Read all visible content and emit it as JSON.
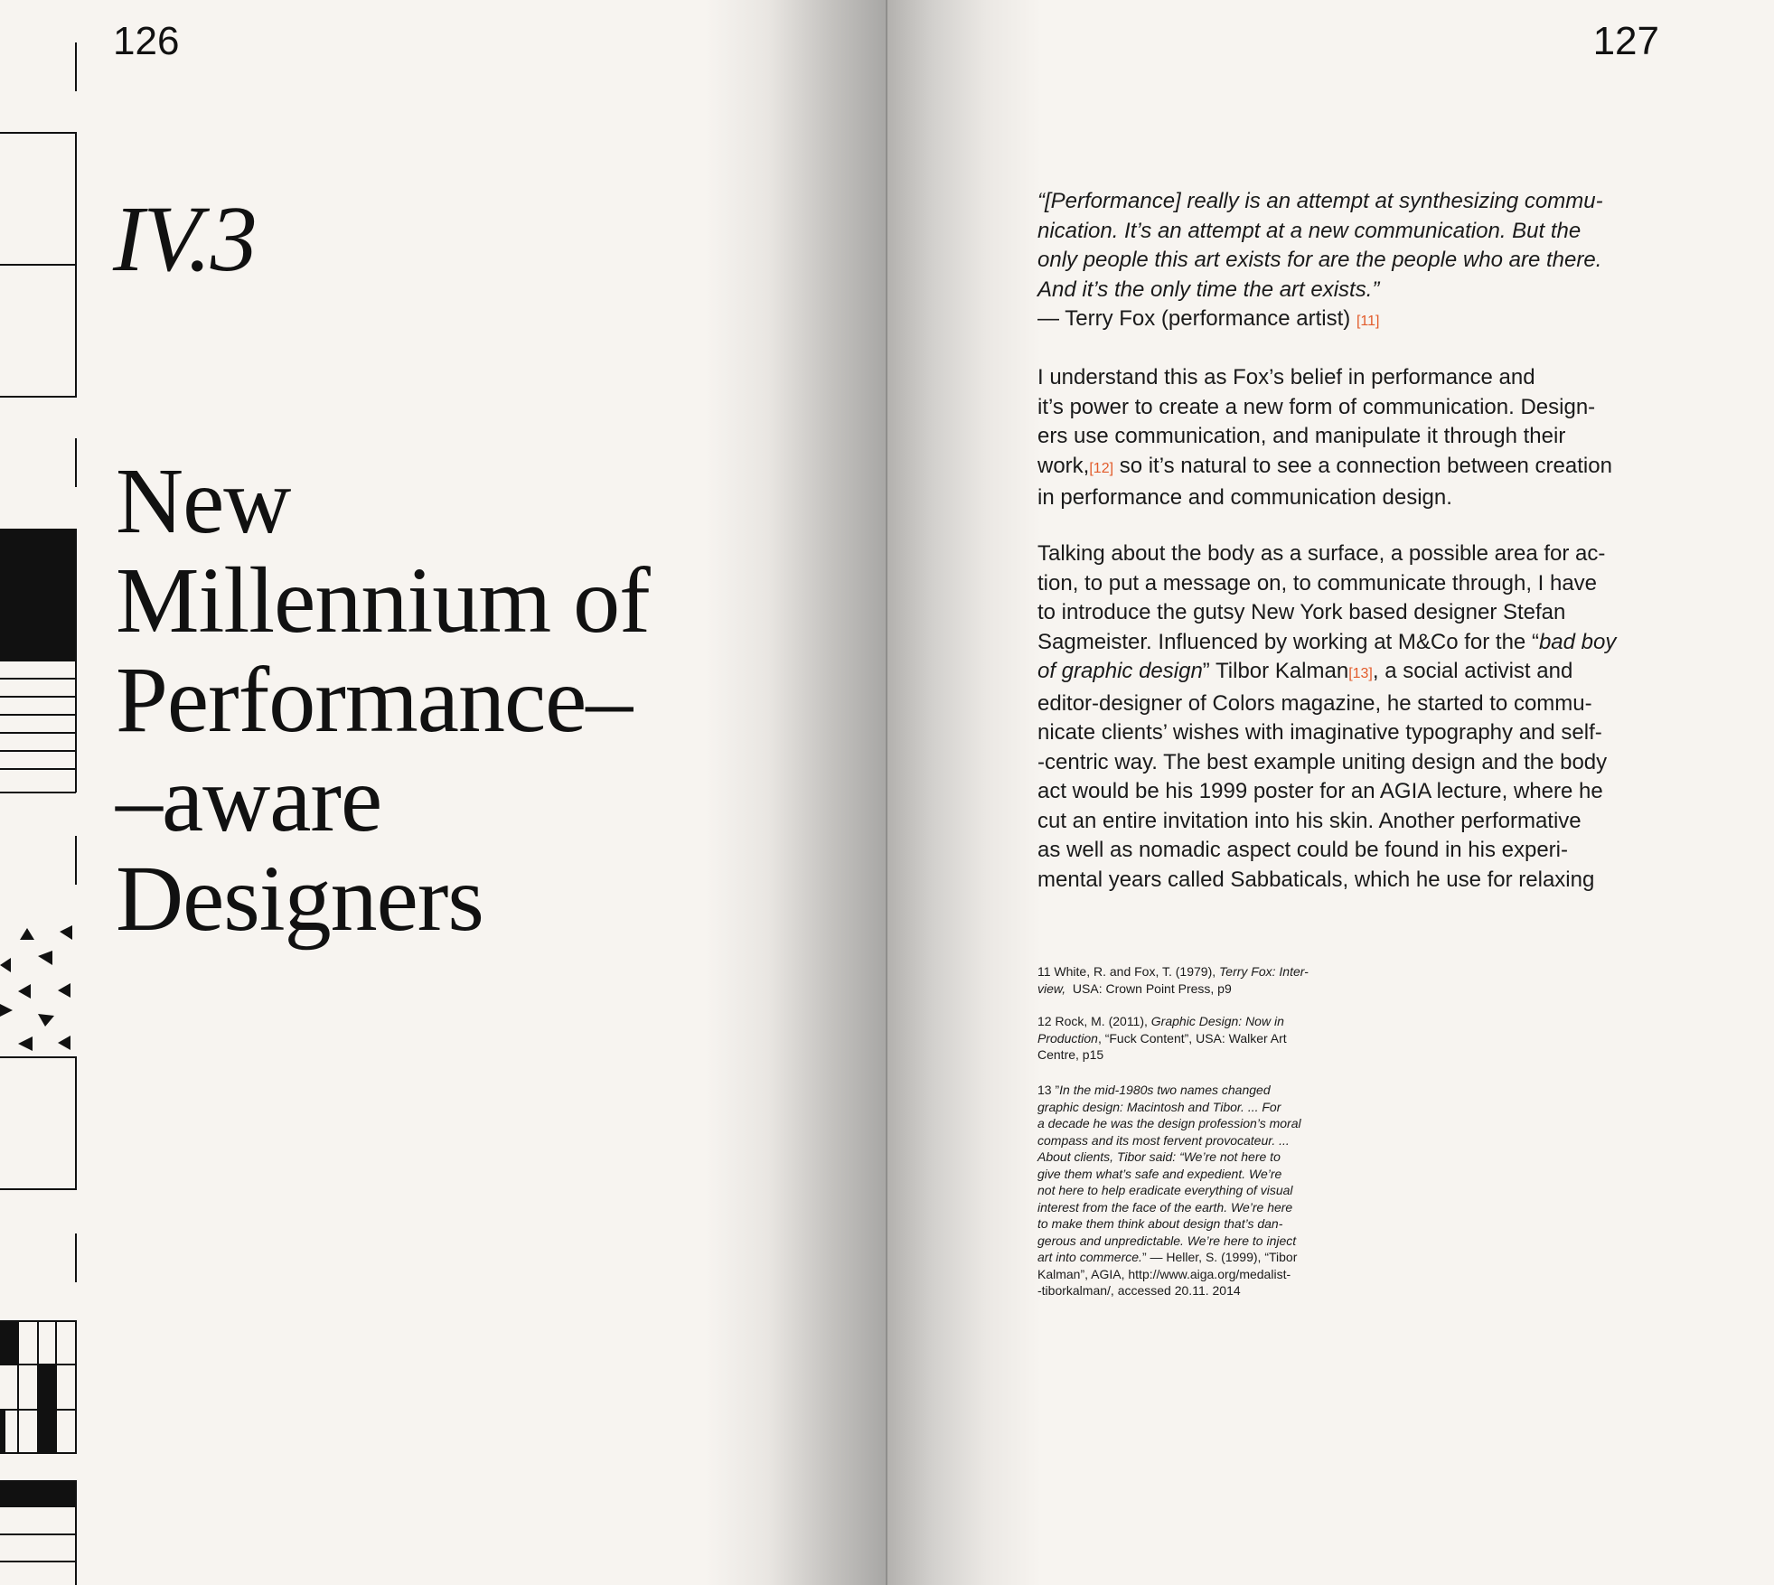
{
  "left_page": {
    "page_number": "126",
    "section_number": "IV.3",
    "title_lines": [
      "New",
      "Millennium of",
      "Performance–",
      "–aware",
      "Designers"
    ]
  },
  "right_page": {
    "page_number": "127",
    "quote_lines": [
      "“[Performance] really is an attempt at synthesizing commu-",
      "nication. It’s an attempt at a new communication. But the",
      "only people this art exists for are the people who are there.",
      "And it’s the only time the art exists.”"
    ],
    "attribution": "— Terry Fox (performance artist)",
    "attribution_ref": "[11]",
    "paragraph1": {
      "line1": "I understand this as Fox’s belief in performance and",
      "line2": "it’s power to create a new form of communication. Design-",
      "line3": "ers use communication, and manipulate it through their",
      "line4_a": "work,",
      "line4_ref": "[12]",
      "line4_b": " so it’s natural to see a connection between creation",
      "line5": "in performance and communication design."
    },
    "paragraph2": {
      "line1": "Talking about the body as a surface, a possible area for ac-",
      "line2": "tion, to put a message on, to communicate through, I have",
      "line3": "to introduce the gutsy New York based designer Stefan",
      "line4_a": "Sagmeister. Influenced by working at M&Co for the “",
      "line4_i": "bad boy",
      "line5_i": "of graphic design",
      "line5_b": "” Tilbor Kalman",
      "line5_ref": "[13]",
      "line5_c": ", a social activist and",
      "line6": "editor-designer of Colors magazine, he started to commu-",
      "line7": "nicate clients’ wishes with imaginative typography and self-",
      "line8": "-centric way. The best example uniting design and the body",
      "line9": "act would be his 1999 poster for an AGIA lecture, where he",
      "line10": "cut an entire invitation into his skin. Another performative",
      "line11": "as well as nomadic aspect could be found in his experi-",
      "line12": "mental years called Sabbaticals, which he use for relaxing"
    },
    "footnotes": {
      "fn11": {
        "line1_a": "11 White, R. and Fox, T. (1979), ",
        "line1_i": "Terry Fox: Inter-",
        "line2_i": "view,",
        "line2_b": "  USA: Crown Point Press, p9"
      },
      "fn12": {
        "line1_a": "12 Rock, M. (2011), ",
        "line1_i": "Graphic Design: Now in",
        "line2_i": "Production",
        "line2_b": ", “Fuck Content”, USA: Walker Art",
        "line3": "Centre, p15"
      },
      "fn13": {
        "line1_a": "13 ”",
        "italic_lines": [
          "In the mid-1980s two names changed",
          "graphic design: Macintosh and Tibor. ... For",
          "a decade he was the design profession’s moral",
          "compass and its most fervent provocateur. ...",
          "About clients, Tibor said: “We’re not here to",
          "give them what’s safe and expedient. We’re",
          "not here to help eradicate everything of visual",
          "interest from the face of the earth. We’re here",
          "to make them think about design that’s dan-",
          "gerous and unpredictable. We’re here to inject"
        ],
        "line11_i": "art into commerce.",
        "line11_b": "” — Heller, S. (1999), “Tibor",
        "line12": "Kalman”, AGIA, http://www.aiga.org/medalist-",
        "line13": "-tiborkalman/, accessed 20.11. 2014"
      }
    }
  },
  "colors": {
    "paper": "#f7f4f0",
    "ink": "#111111",
    "reference_accent": "#e25b2a"
  }
}
